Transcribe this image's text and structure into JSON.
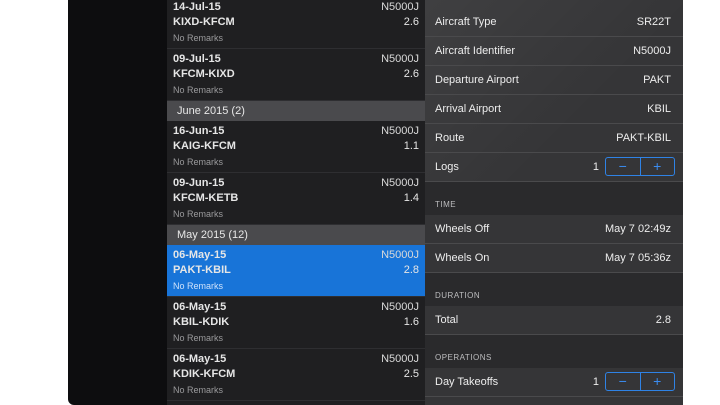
{
  "flights_top": [
    {
      "date": "14-Jul-15",
      "ident": "N5000J",
      "route": "KIXD-KFCM",
      "total": "2.6",
      "remarks": "No Remarks"
    },
    {
      "date": "09-Jul-15",
      "ident": "N5000J",
      "route": "KFCM-KIXD",
      "total": "2.6",
      "remarks": "No Remarks"
    }
  ],
  "section_june": "June 2015 (2)",
  "flights_june": [
    {
      "date": "16-Jun-15",
      "ident": "N5000J",
      "route": "KAIG-KFCM",
      "total": "1.1",
      "remarks": "No Remarks"
    },
    {
      "date": "09-Jun-15",
      "ident": "N5000J",
      "route": "KFCM-KETB",
      "total": "1.4",
      "remarks": "No Remarks"
    }
  ],
  "section_may": "May 2015 (12)",
  "flights_may": [
    {
      "date": "06-May-15",
      "ident": "N5000J",
      "route": "PAKT-KBIL",
      "total": "2.8",
      "remarks": "No Remarks"
    },
    {
      "date": "06-May-15",
      "ident": "N5000J",
      "route": "KBIL-KDIK",
      "total": "1.6",
      "remarks": "No Remarks"
    },
    {
      "date": "06-May-15",
      "ident": "N5000J",
      "route": "KDIK-KFCM",
      "total": "2.5",
      "remarks": "No Remarks"
    }
  ],
  "detail": {
    "aircraft_type": {
      "label": "Aircraft Type",
      "value": "SR22T"
    },
    "aircraft_identifier": {
      "label": "Aircraft Identifier",
      "value": "N5000J"
    },
    "departure_airport": {
      "label": "Departure Airport",
      "value": "PAKT"
    },
    "arrival_airport": {
      "label": "Arrival Airport",
      "value": "KBIL"
    },
    "route": {
      "label": "Route",
      "value": "PAKT-KBIL"
    },
    "logs": {
      "label": "Logs",
      "value": "1",
      "minus": "−",
      "plus": "+"
    },
    "time_header": "TIME",
    "wheels_off": {
      "label": "Wheels Off",
      "value": "May 7  02:49z"
    },
    "wheels_on": {
      "label": "Wheels On",
      "value": "May 7  05:36z"
    },
    "duration_header": "DURATION",
    "total": {
      "label": "Total",
      "value": "2.8"
    },
    "operations_header": "OPERATIONS",
    "day_takeoffs": {
      "label": "Day Takeoffs",
      "value": "1",
      "minus": "−",
      "plus": "+"
    }
  },
  "colors": {
    "accent": "#1874d8",
    "stepper": "#2f83e6"
  }
}
